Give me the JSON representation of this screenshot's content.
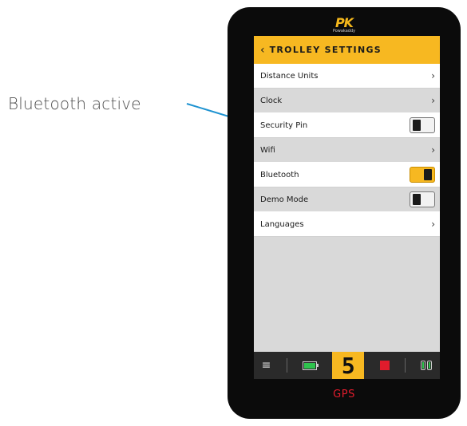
{
  "annotation": {
    "text": "Bluetooth active",
    "arrow_color": "#1f93d1"
  },
  "device": {
    "logo": {
      "mark": "PK",
      "subtext": "Powakaddy"
    },
    "header": {
      "back_icon": "‹",
      "title": "TROLLEY SETTINGS"
    },
    "settings": [
      {
        "label": "Distance Units",
        "control": "chevron",
        "bg": "white"
      },
      {
        "label": "Clock",
        "control": "chevron",
        "bg": "gray"
      },
      {
        "label": "Security Pin",
        "control": "toggle",
        "state": "off",
        "bg": "white"
      },
      {
        "label": "Wifi",
        "control": "chevron",
        "bg": "gray"
      },
      {
        "label": "Bluetooth",
        "control": "toggle",
        "state": "on",
        "bg": "white"
      },
      {
        "label": "Demo Mode",
        "control": "toggle",
        "state": "off",
        "bg": "gray"
      },
      {
        "label": "Languages",
        "control": "chevron",
        "bg": "white"
      }
    ],
    "chevron_glyph": "›",
    "bottom_bar": {
      "menu_icon": "≡",
      "speed_level": "5"
    },
    "mode_label": "GPS",
    "colors": {
      "accent": "#f7b821",
      "stop": "#e01c2c",
      "battery": "#2ec44d"
    }
  }
}
